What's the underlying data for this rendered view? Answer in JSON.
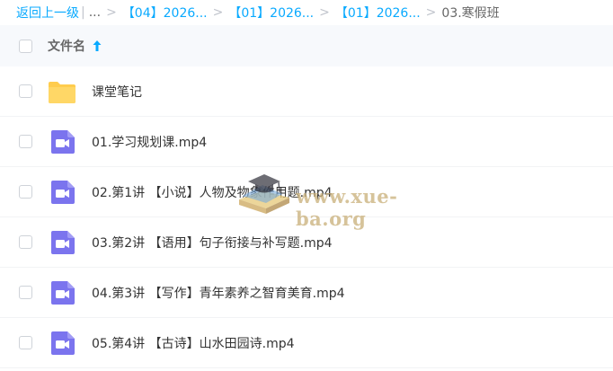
{
  "breadcrumb": {
    "back": "返回上一级",
    "ellipsis": "...",
    "items": [
      "【04】2026...",
      "【01】2026...",
      "【01】2026..."
    ],
    "current": "03.寒假班"
  },
  "header": {
    "column_label": "文件名"
  },
  "files": [
    {
      "name": "课堂笔记",
      "type": "folder"
    },
    {
      "name": "01.学习规划课.mp4",
      "type": "video"
    },
    {
      "name": "02.第1讲 【小说】人物及物象作用题.mp4",
      "type": "video"
    },
    {
      "name": "03.第2讲 【语用】句子衔接与补写题.mp4",
      "type": "video"
    },
    {
      "name": "04.第3讲 【写作】青年素养之智育美育.mp4",
      "type": "video"
    },
    {
      "name": "05.第4讲 【古诗】山水田园诗.mp4",
      "type": "video"
    }
  ],
  "watermark": {
    "text": "www.xue-ba.org"
  },
  "colors": {
    "accent": "#09aaff",
    "folder": "#ffcc4d",
    "video": "#7b74ee"
  }
}
